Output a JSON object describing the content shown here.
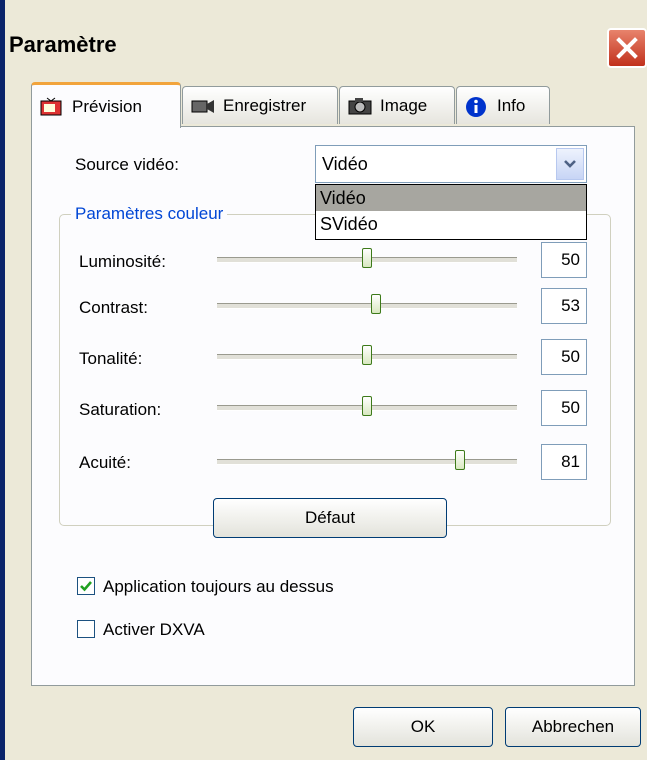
{
  "window": {
    "title": "Paramètre"
  },
  "tabs": [
    {
      "label": "Prévision",
      "icon": "preview-tv-icon",
      "active": true
    },
    {
      "label": "Enregistrer",
      "icon": "record-camera-icon",
      "active": false
    },
    {
      "label": "Image",
      "icon": "photo-camera-icon",
      "active": false
    },
    {
      "label": "Info",
      "icon": "info-icon",
      "active": false
    }
  ],
  "source": {
    "label": "Source vidéo:",
    "value": "Vidéo",
    "options": [
      "Vidéo",
      "SVidéo"
    ],
    "highlighted_option": "Vidéo"
  },
  "color_group": {
    "title": "Paramètres couleur",
    "sliders": [
      {
        "label": "Luminosité:",
        "value": "50",
        "level": 0.5
      },
      {
        "label": "Contrast:",
        "value": "53",
        "level": 0.53
      },
      {
        "label": "Tonalité:",
        "value": "50",
        "level": 0.5
      },
      {
        "label": "Saturation:",
        "value": "50",
        "level": 0.5
      },
      {
        "label": "Acuité:",
        "value": "81",
        "level": 0.81
      }
    ],
    "default_button": "Défaut"
  },
  "options": {
    "always_on_top": {
      "label": "Application toujours au dessus",
      "checked": true
    },
    "dxva": {
      "label": "Activer DXVA",
      "checked": false
    }
  },
  "buttons": {
    "ok": "OK",
    "cancel": "Abbrechen"
  },
  "colors": {
    "accent_tab": "#f2a43c",
    "group_title": "#0046d5",
    "close": "#c1311c"
  }
}
